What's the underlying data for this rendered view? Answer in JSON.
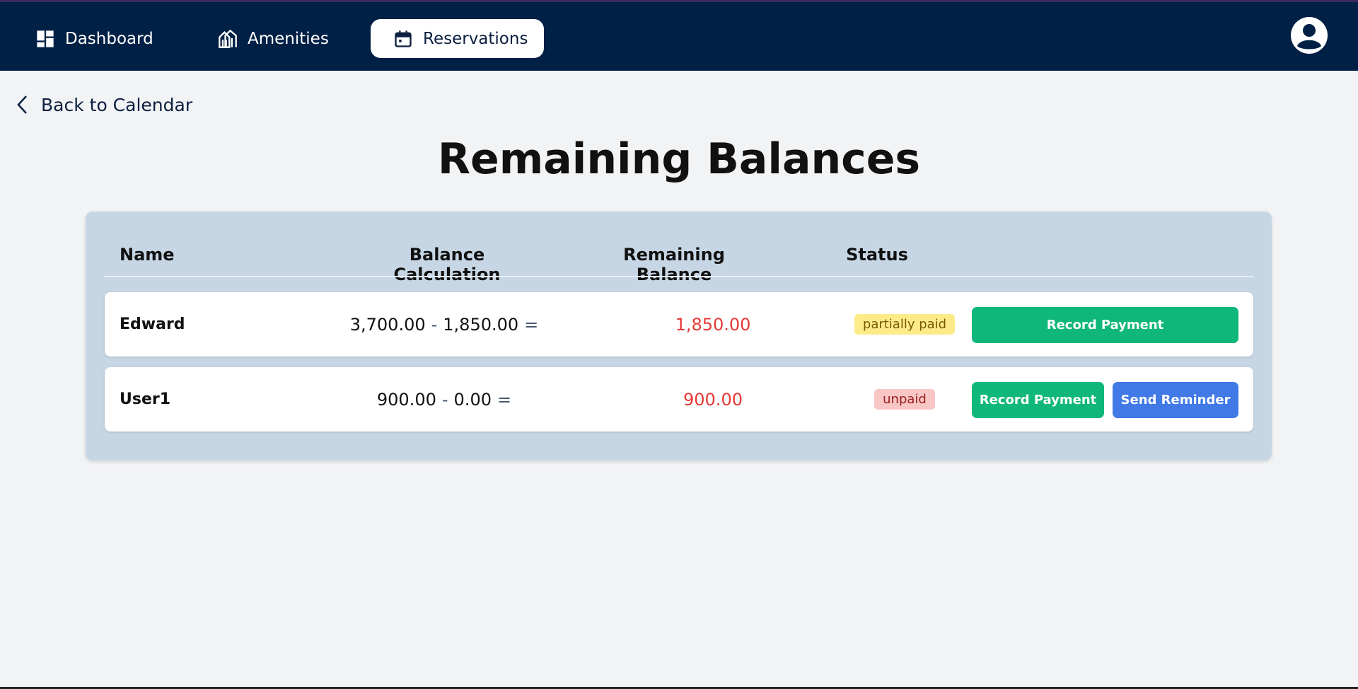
{
  "nav": {
    "items": [
      {
        "label": "Dashboard",
        "icon": "dashboard-icon"
      },
      {
        "label": "Amenities",
        "icon": "amenities-icon"
      },
      {
        "label": "Reservations",
        "icon": "calendar-icon",
        "active": true
      }
    ],
    "avatar_icon": "user-avatar-icon"
  },
  "back": {
    "label": "Back to Calendar",
    "icon": "chevron-left-icon"
  },
  "page": {
    "title": "Remaining Balances"
  },
  "table": {
    "headers": {
      "name": "Name",
      "calculation": "Balance Calculation",
      "remaining": "Remaining Balance",
      "status": "Status"
    },
    "rows": [
      {
        "name": "Edward",
        "total": "3,700.00",
        "minus": "-",
        "paid": "1,850.00",
        "equals": "=",
        "remaining": "1,850.00",
        "status": "partially paid",
        "actions": {
          "record": "Record Payment"
        }
      },
      {
        "name": "User1",
        "total": "900.00",
        "minus": "-",
        "paid": "0.00",
        "equals": "=",
        "remaining": "900.00",
        "status": "unpaid",
        "actions": {
          "record": "Record Payment",
          "remind": "Send Reminder"
        }
      }
    ]
  },
  "colors": {
    "topbar": "#002046",
    "remaining_text": "#e53935",
    "record_button": "#10b77b",
    "reminder_button": "#4179e6",
    "panel": "#c7d6e4"
  }
}
